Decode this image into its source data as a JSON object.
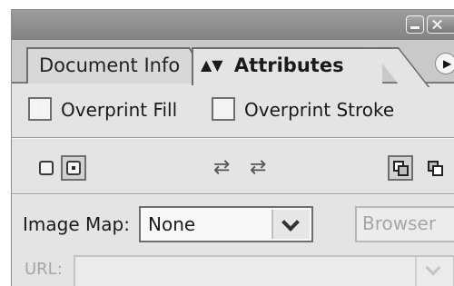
{
  "tabs": [
    {
      "label": "Document Info",
      "active": false
    },
    {
      "label": "Attributes",
      "active": true
    }
  ],
  "overprint": {
    "fill_label": "Overprint Fill",
    "fill_checked": false,
    "stroke_label": "Overprint Stroke",
    "stroke_checked": false
  },
  "icons": {
    "row": [
      "center-point-off-icon",
      "center-point-on-icon",
      "reverse-path-direction-off-icon",
      "reverse-path-direction-on-icon",
      "non-zero-winding-fill-icon",
      "even-odd-fill-icon"
    ],
    "glyph_swap": "⇄"
  },
  "image_map": {
    "label": "Image Map:",
    "value": "None",
    "browser_label": "Browser"
  },
  "url": {
    "label": "URL:",
    "value": ""
  },
  "colors": {
    "titlebar": "#8f8f8f",
    "panel_bg": "#e4e4e4",
    "disabled_text": "#a6a6a6"
  }
}
